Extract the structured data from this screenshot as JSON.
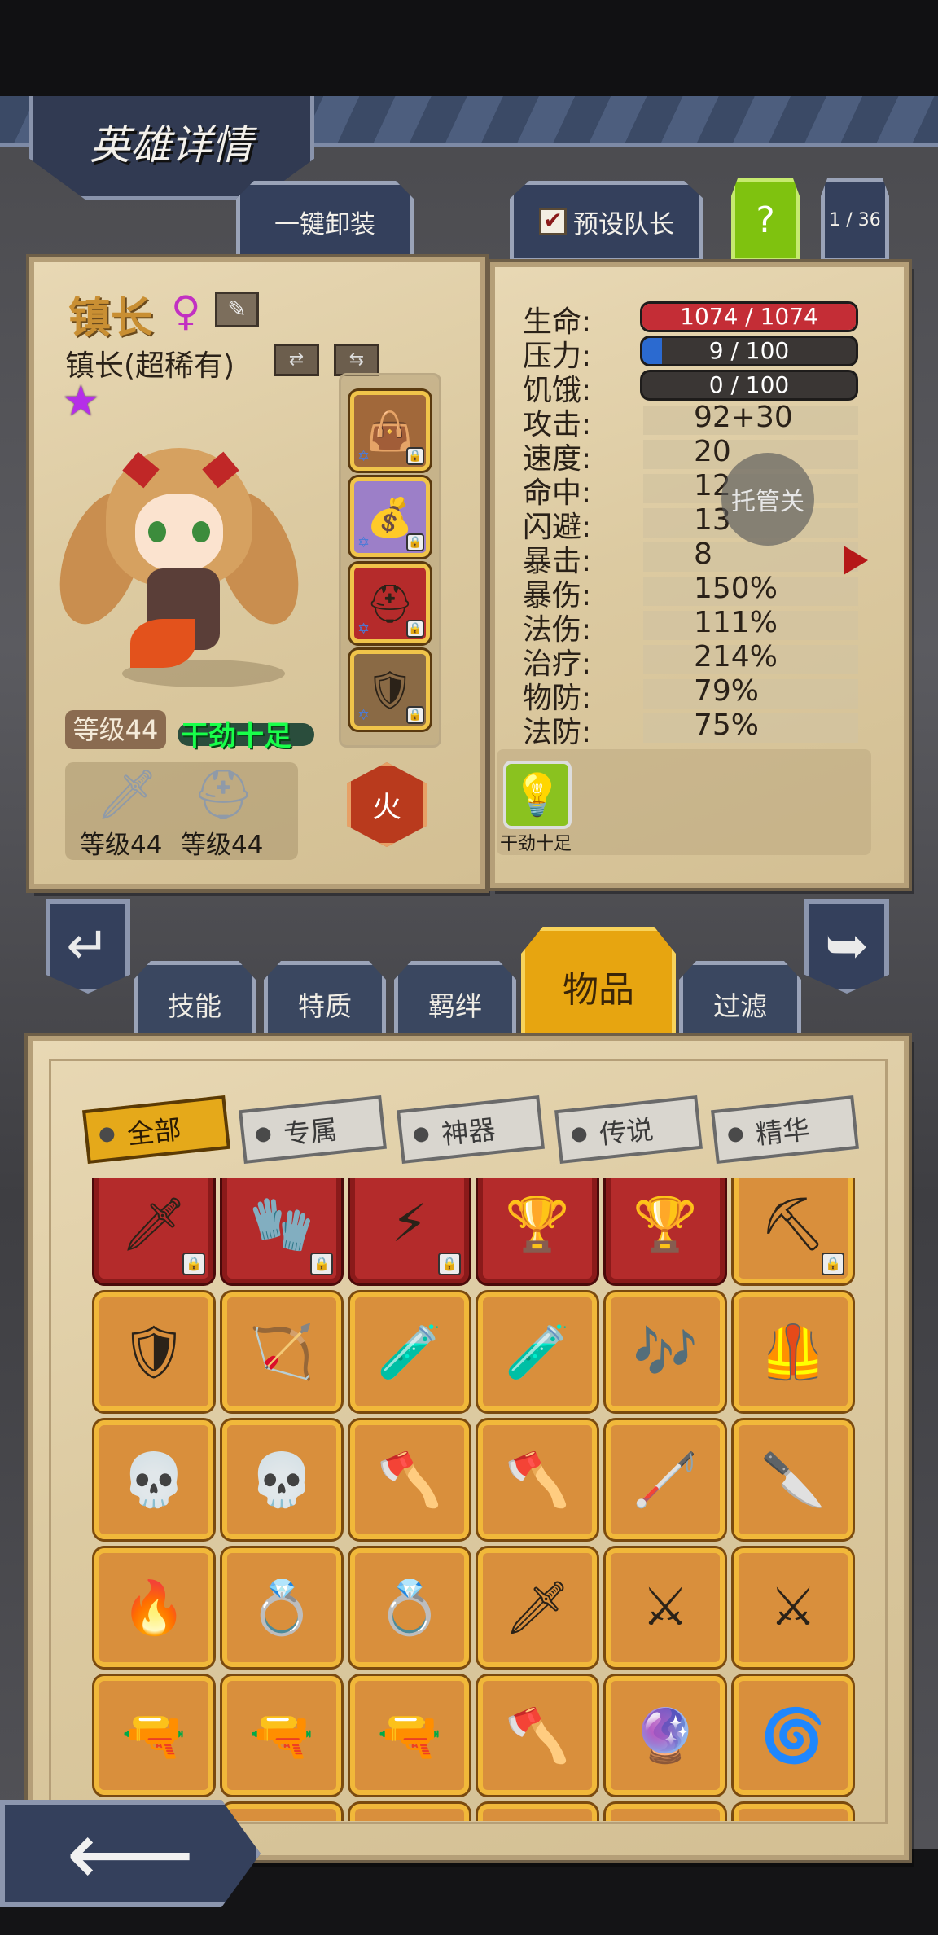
{
  "header": {
    "title": "英雄详情"
  },
  "top_buttons": {
    "unequip_all": "一键卸装",
    "preset_leader": "预设队长",
    "help": "?",
    "page": "1 / 36"
  },
  "hero": {
    "name": "镇长",
    "class": "镇长(超稀有)",
    "level": "等级44",
    "mood": "干劲十足",
    "element": "火",
    "gear": [
      {
        "icon": "sword",
        "level": "等级44"
      },
      {
        "icon": "helmet",
        "level": "等级44"
      }
    ]
  },
  "stats": [
    {
      "label": "生命:",
      "value": "1074 / 1074",
      "type": "bar",
      "fill": 1.0,
      "color": "#c42d36"
    },
    {
      "label": "压力:",
      "value": "9 / 100",
      "type": "bar",
      "fill": 0.09,
      "color": "#2b6ad0"
    },
    {
      "label": "饥饿:",
      "value": "0 / 100",
      "type": "bar",
      "fill": 0.0,
      "color": "#2b6ad0"
    },
    {
      "label": "攻击:",
      "value": "92+30"
    },
    {
      "label": "速度:",
      "value": "20"
    },
    {
      "label": "命中:",
      "value": "12"
    },
    {
      "label": "闪避:",
      "value": "13"
    },
    {
      "label": "暴击:",
      "value": "8"
    },
    {
      "label": "暴伤:",
      "value": "150%"
    },
    {
      "label": "法伤:",
      "value": "111%"
    },
    {
      "label": "治疗:",
      "value": "214%"
    },
    {
      "label": "物防:",
      "value": "79%"
    },
    {
      "label": "法防:",
      "value": "75%"
    }
  ],
  "trust_button": "托管关",
  "trait": {
    "label": "干劲十足"
  },
  "tabs": [
    "技能",
    "特质",
    "羁绊",
    "物品",
    "过滤"
  ],
  "filters": [
    "全部",
    "专属",
    "神器",
    "传说",
    "精华"
  ],
  "items": [
    {
      "icon": "spear-icon",
      "glyph": "🗡",
      "frame": "red",
      "locked": true
    },
    {
      "icon": "claw-gauntlet-icon",
      "glyph": "🧤",
      "frame": "red",
      "locked": true
    },
    {
      "icon": "thunder-axe-icon",
      "glyph": "⚡",
      "frame": "red",
      "locked": true
    },
    {
      "icon": "blood-chalice-icon",
      "glyph": "🏆",
      "frame": "red",
      "locked": false
    },
    {
      "icon": "blood-chalice-icon",
      "glyph": "🏆",
      "frame": "red",
      "locked": false
    },
    {
      "icon": "pickaxe-icon",
      "glyph": "⛏",
      "frame": "gold",
      "locked": true
    },
    {
      "icon": "shield-icon",
      "glyph": "🛡",
      "frame": "gold",
      "locked": false
    },
    {
      "icon": "crossbow-icon",
      "glyph": "🏹",
      "frame": "gold",
      "locked": false
    },
    {
      "icon": "green-potion-icon",
      "glyph": "🧪",
      "frame": "gold",
      "locked": false
    },
    {
      "icon": "green-potion-icon",
      "glyph": "🧪",
      "frame": "gold",
      "locked": false
    },
    {
      "icon": "flute-icon",
      "glyph": "🎶",
      "frame": "gold",
      "locked": false
    },
    {
      "icon": "armor-icon",
      "glyph": "🦺",
      "frame": "gold",
      "locked": false
    },
    {
      "icon": "skull-cloak-icon",
      "glyph": "💀",
      "frame": "gold",
      "locked": false
    },
    {
      "icon": "skull-cloak-icon",
      "glyph": "💀",
      "frame": "gold",
      "locked": false
    },
    {
      "icon": "battle-axe-icon",
      "glyph": "🪓",
      "frame": "gold",
      "locked": false
    },
    {
      "icon": "battle-axe-icon",
      "glyph": "🪓",
      "frame": "gold",
      "locked": false
    },
    {
      "icon": "dark-staff-icon",
      "glyph": "🦯",
      "frame": "gold",
      "locked": false
    },
    {
      "icon": "cleaver-icon",
      "glyph": "🔪",
      "frame": "gold",
      "locked": false
    },
    {
      "icon": "flame-sword-icon",
      "glyph": "🔥",
      "frame": "gold",
      "locked": false
    },
    {
      "icon": "ruby-ring-icon",
      "glyph": "💍",
      "frame": "gold",
      "locked": false
    },
    {
      "icon": "ruby-ring-icon",
      "glyph": "💍",
      "frame": "gold",
      "locked": false
    },
    {
      "icon": "short-sword-icon",
      "glyph": "🗡",
      "frame": "gold",
      "locked": false
    },
    {
      "icon": "katana-icon",
      "glyph": "⚔",
      "frame": "gold",
      "locked": false
    },
    {
      "icon": "katana-icon",
      "glyph": "⚔",
      "frame": "gold",
      "locked": false
    },
    {
      "icon": "pistol-icon",
      "glyph": "🔫",
      "frame": "gold",
      "locked": false
    },
    {
      "icon": "pistol-icon",
      "glyph": "🔫",
      "frame": "gold",
      "locked": false
    },
    {
      "icon": "pistol-icon",
      "glyph": "🔫",
      "frame": "gold",
      "locked": false
    },
    {
      "icon": "great-axe-icon",
      "glyph": "🪓",
      "frame": "gold",
      "locked": false
    },
    {
      "icon": "gem-staff-icon",
      "glyph": "🔮",
      "frame": "gold",
      "locked": false
    },
    {
      "icon": "drill-lance-icon",
      "glyph": "🌀",
      "frame": "gold",
      "locked": false
    },
    {
      "icon": "item-partial-icon",
      "glyph": "",
      "frame": "gold",
      "locked": false
    },
    {
      "icon": "item-partial-icon",
      "glyph": "",
      "frame": "gold",
      "locked": false
    },
    {
      "icon": "item-partial-icon",
      "glyph": "",
      "frame": "gold",
      "locked": false
    },
    {
      "icon": "item-partial-icon",
      "glyph": "",
      "frame": "gold",
      "locked": false
    },
    {
      "icon": "item-partial-icon",
      "glyph": "",
      "frame": "gold",
      "locked": false
    },
    {
      "icon": "item-partial-icon",
      "glyph": "",
      "frame": "gold",
      "locked": false
    }
  ]
}
